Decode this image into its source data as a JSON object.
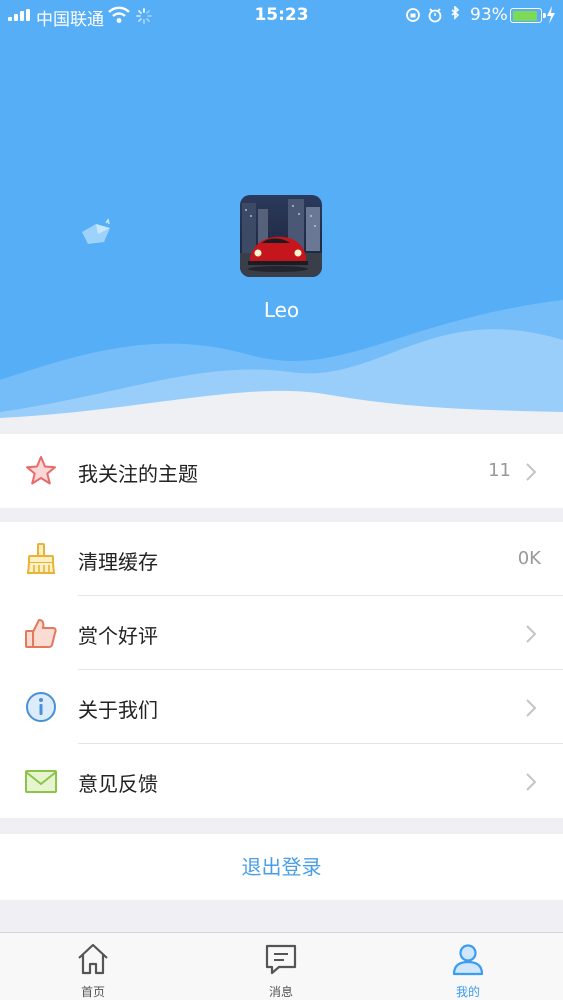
{
  "status_bar": {
    "carrier": "中国联通",
    "time": "15:23",
    "battery": "93%",
    "battery_level": 0.93
  },
  "profile": {
    "username": "Leo",
    "avatar_icon": "red-car-avatar"
  },
  "list_primary": [
    {
      "label": "我关注的主题",
      "value": "11",
      "icon": "star-icon"
    }
  ],
  "list_secondary": [
    {
      "label": "清理缓存",
      "value": "0K",
      "icon": "broom-icon"
    },
    {
      "label": "赏个好评",
      "value": "",
      "icon": "thumbs-up-icon"
    },
    {
      "label": "关于我们",
      "value": "",
      "icon": "info-icon"
    },
    {
      "label": "意见反馈",
      "value": "",
      "icon": "mail-icon"
    }
  ],
  "logout_label": "退出登录",
  "tabbar": {
    "tabs": [
      {
        "label": "首页",
        "icon": "home-icon",
        "active": false
      },
      {
        "label": "消息",
        "icon": "message-icon",
        "active": false
      },
      {
        "label": "我的",
        "icon": "profile-icon",
        "active": true
      }
    ]
  },
  "colors": {
    "header_blue": "#56aef7",
    "accent": "#3b9cf0",
    "logout_text": "#4a9ee6"
  }
}
